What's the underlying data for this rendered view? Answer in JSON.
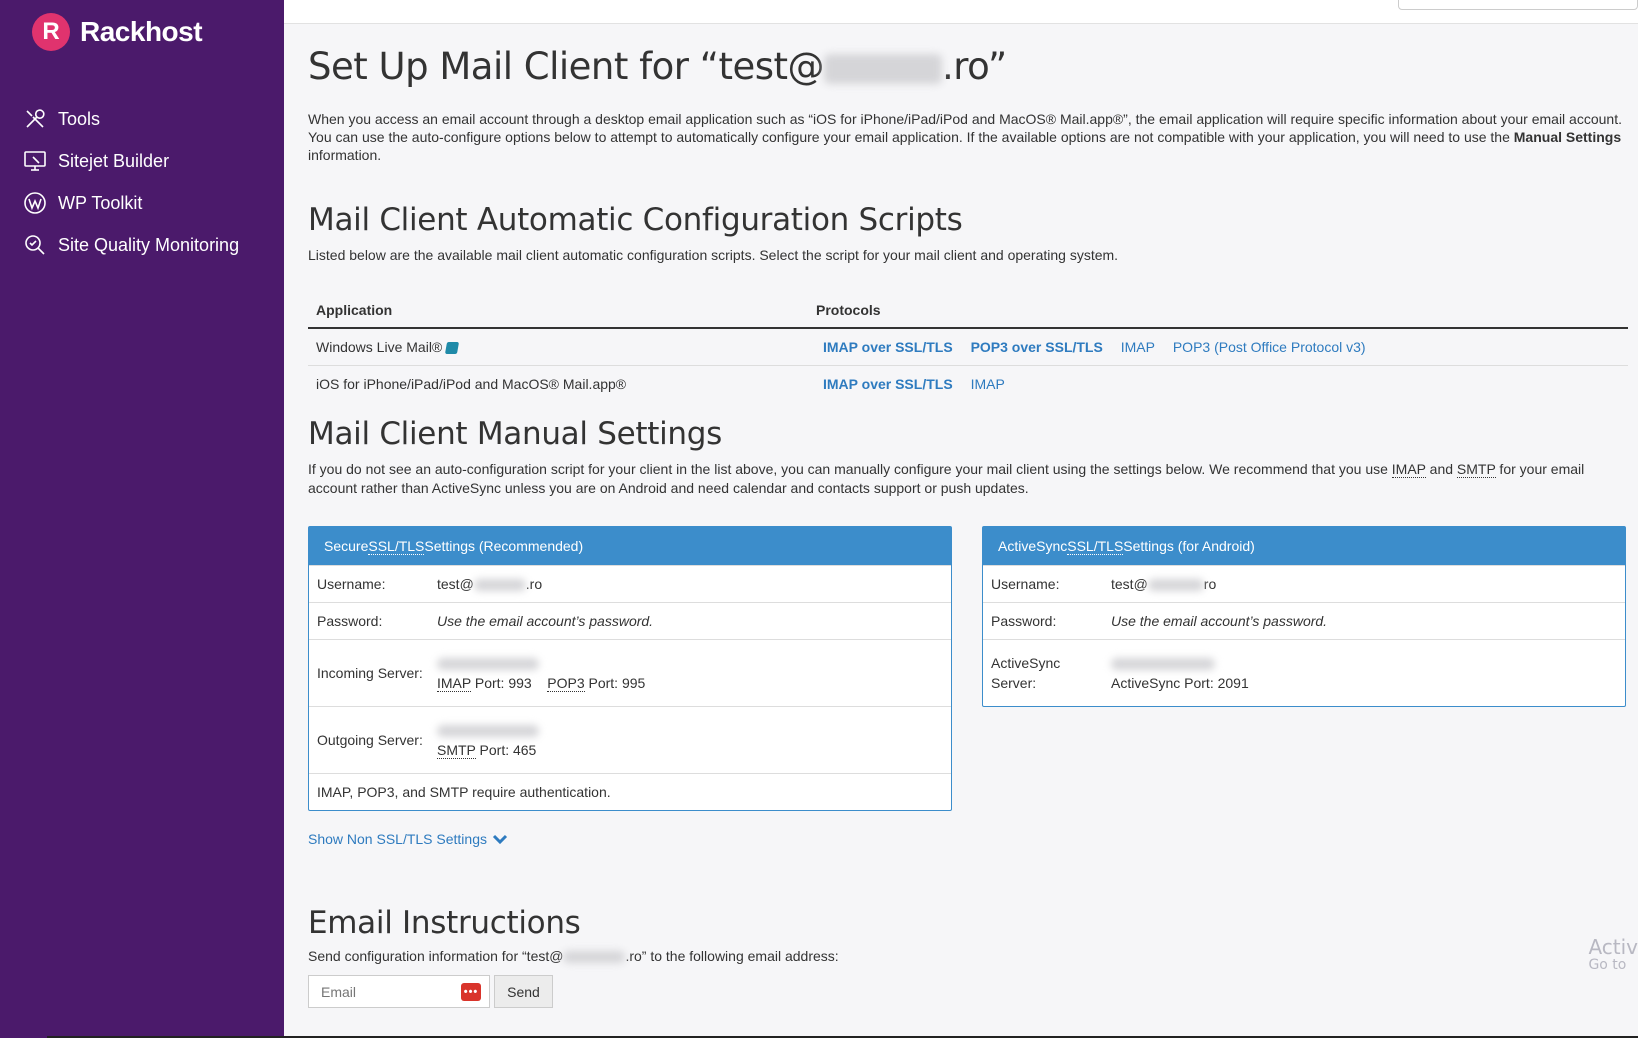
{
  "brand": {
    "logo_letter": "R",
    "name": "Rackhost"
  },
  "sidebar": {
    "items": [
      {
        "label": "Tools",
        "icon": "tools-icon"
      },
      {
        "label": "Sitejet Builder",
        "icon": "sitejet-icon"
      },
      {
        "label": "WP Toolkit",
        "icon": "wordpress-icon"
      },
      {
        "label": "Site Quality Monitoring",
        "icon": "site-quality-icon"
      }
    ]
  },
  "page": {
    "title_prefix": "Set Up Mail Client for “test@",
    "title_suffix": ".ro”",
    "intro_1": "When you access an email account through a desktop email application such as “iOS for iPhone/iPad/iPod and MacOS® Mail.app®”, the email application will require specific information about your email account. You can use the auto-configure options below to attempt to automatically configure your email application. If the available options are not compatible with your application, you will need to use the ",
    "intro_bold": "Manual Settings",
    "intro_2": " information."
  },
  "auto": {
    "heading": "Mail Client Automatic Configuration Scripts",
    "subtext": "Listed below are the available mail client automatic configuration scripts. Select the script for your mail client and operating system.",
    "col_application": "Application",
    "col_protocols": "Protocols",
    "rows": [
      {
        "app": "Windows Live Mail®",
        "protocols": [
          "IMAP over SSL/TLS",
          "POP3 over SSL/TLS",
          "IMAP",
          "POP3 (Post Office Protocol v3)"
        ]
      },
      {
        "app": "iOS for iPhone/iPad/iPod and MacOS® Mail.app®",
        "protocols": [
          "IMAP over SSL/TLS",
          "IMAP"
        ]
      }
    ]
  },
  "manual": {
    "heading": "Mail Client Manual Settings",
    "desc_1": "If you do not see an auto-configuration script for your client in the list above, you can manually configure your mail client using the settings below. We recommend that you use ",
    "desc_imap": "IMAP",
    "desc_and": " and ",
    "desc_smtp": "SMTP",
    "desc_2": " for your email account rather than ActiveSync unless you are on Android and need calendar and contacts support or push updates.",
    "secure": {
      "head_1": "Secure ",
      "head_abbr": "SSL/TLS",
      "head_2": " Settings (Recommended)",
      "username_label": "Username:",
      "username_prefix": "test@",
      "username_suffix": ".ro",
      "password_label": "Password:",
      "password_value": "Use the email account’s password.",
      "incoming_label": "Incoming Server:",
      "imap_abbr": "IMAP",
      "imap_port": " Port: 993",
      "pop3_abbr": "POP3",
      "pop3_port": " Port: 995",
      "outgoing_label": "Outgoing Server:",
      "smtp_abbr": "SMTP",
      "smtp_port": " Port: 465",
      "note": "IMAP, POP3, and SMTP require authentication."
    },
    "activesync": {
      "head_1": "ActiveSync ",
      "head_abbr": "SSL/TLS",
      "head_2": " Settings (for Android)",
      "username_label": "Username:",
      "username_prefix": "test@",
      "username_suffix": "ro",
      "password_label": "Password:",
      "password_value": "Use the email account’s password.",
      "server_label": "ActiveSync Server:",
      "port_text": "ActiveSync Port: 2091"
    },
    "toggle_label": "Show Non SSL/TLS Settings"
  },
  "instructions": {
    "heading": "Email Instructions",
    "text_prefix": "Send configuration information for “test@",
    "text_suffix": ".ro” to the following email address:",
    "email_placeholder": "Email",
    "send_label": "Send"
  },
  "watermark": {
    "line1": "Activ",
    "line2": "Go to"
  },
  "colors": {
    "sidebar": "#4b1a6b",
    "accent": "#3c8dcb",
    "link": "#2e7bbf",
    "brand": "#e0336e"
  }
}
